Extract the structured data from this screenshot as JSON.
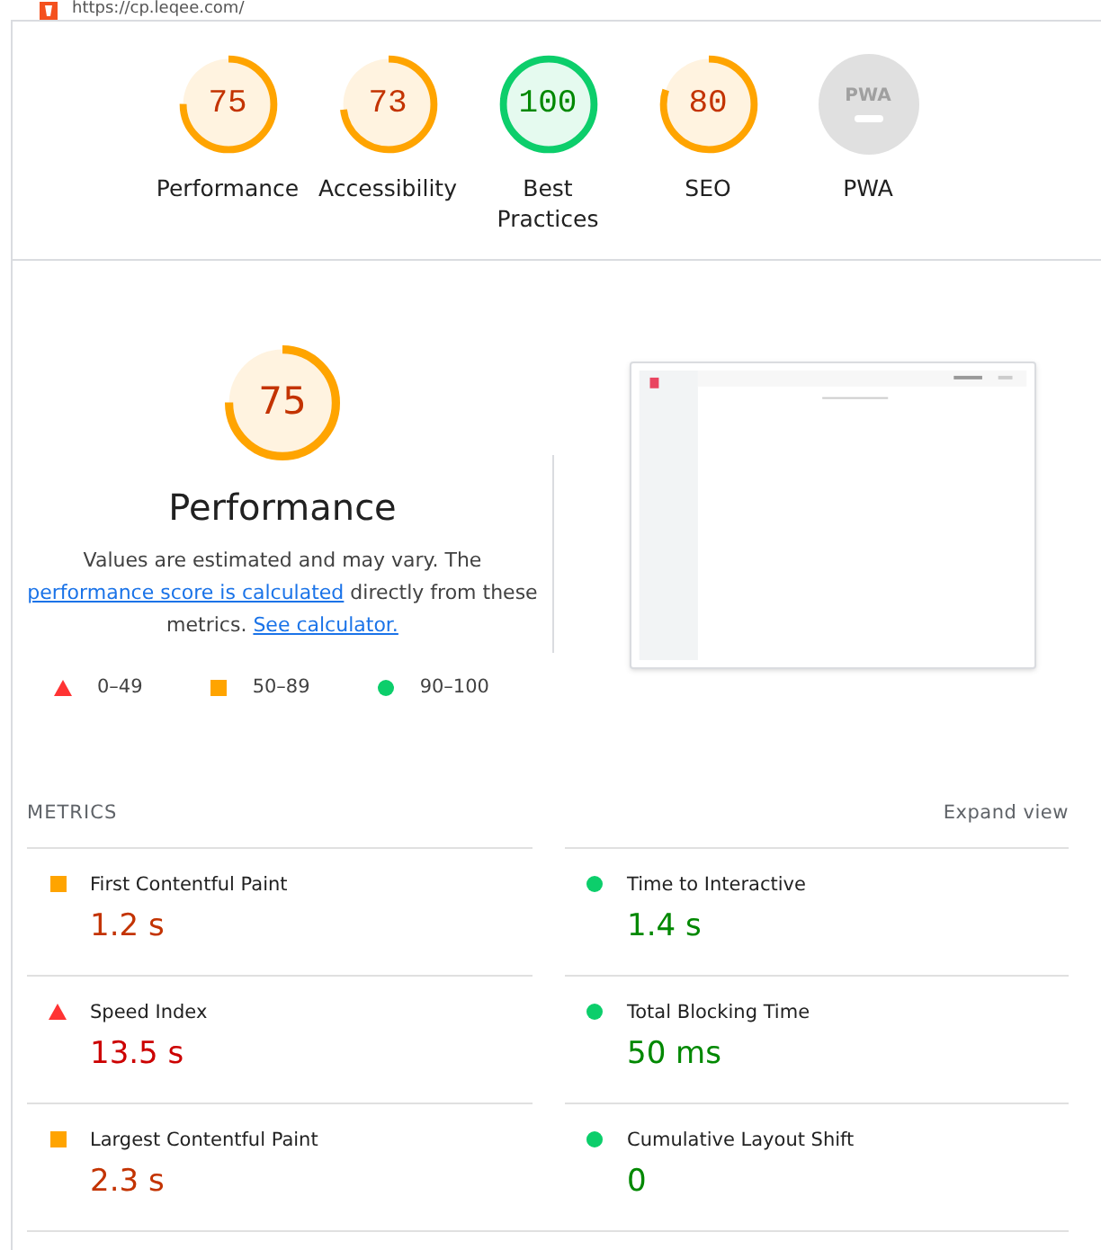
{
  "address_bar": {
    "url": "https://cp.leqee.com/"
  },
  "gauges": [
    {
      "kind": "score",
      "score": "75",
      "label": "Performance",
      "color": "#ffa400",
      "level": 0.75
    },
    {
      "kind": "score",
      "score": "73",
      "label": "Accessibility",
      "color": "#ffa400",
      "level": 0.73
    },
    {
      "kind": "score",
      "score": "100",
      "label": "Best Practices",
      "color": "#0cce6b",
      "level": 1
    },
    {
      "kind": "score",
      "score": "80",
      "label": "SEO",
      "color": "#ffa400",
      "level": 0.8
    },
    {
      "kind": "pwa",
      "score": "PWA",
      "label": "PWA"
    }
  ],
  "performance": {
    "score": "75",
    "color": "#ffa400",
    "level": 0.75,
    "title": "Performance",
    "description": [
      {
        "kind": "text",
        "text": "Values are estimated and may vary. The "
      },
      {
        "kind": "link",
        "text": "performance score is calculated"
      },
      {
        "kind": "text",
        "text": " directly from these metrics. "
      },
      {
        "kind": "link",
        "text": "See calculator."
      }
    ],
    "legend": [
      {
        "kind": "triangle",
        "color": "#ff3333",
        "text": "0–49"
      },
      {
        "kind": "square",
        "color": "#ffa400",
        "text": "50–89"
      },
      {
        "kind": "circle",
        "color": "#0cce6b",
        "text": "90–100"
      }
    ]
  },
  "metrics": {
    "title": "METRICS",
    "toggle": "Expand view",
    "items": [
      {
        "label": "First Contentful Paint",
        "value": "1.2 s",
        "kind": "square",
        "color": "#ffa400"
      },
      {
        "label": "Time to Interactive",
        "value": "1.4 s",
        "kind": "circle",
        "color": "#0cce6b"
      },
      {
        "label": "Speed Index",
        "value": "13.5 s",
        "kind": "triangle",
        "color": "#ff3333"
      },
      {
        "label": "Total Blocking Time",
        "value": "50 ms",
        "kind": "circle",
        "color": "#0cce6b"
      },
      {
        "label": "Largest Contentful Paint",
        "value": "2.3 s",
        "kind": "square",
        "color": "#ffa400"
      },
      {
        "label": "Cumulative Layout Shift",
        "value": "0",
        "kind": "circle",
        "color": "#0cce6b"
      }
    ]
  }
}
